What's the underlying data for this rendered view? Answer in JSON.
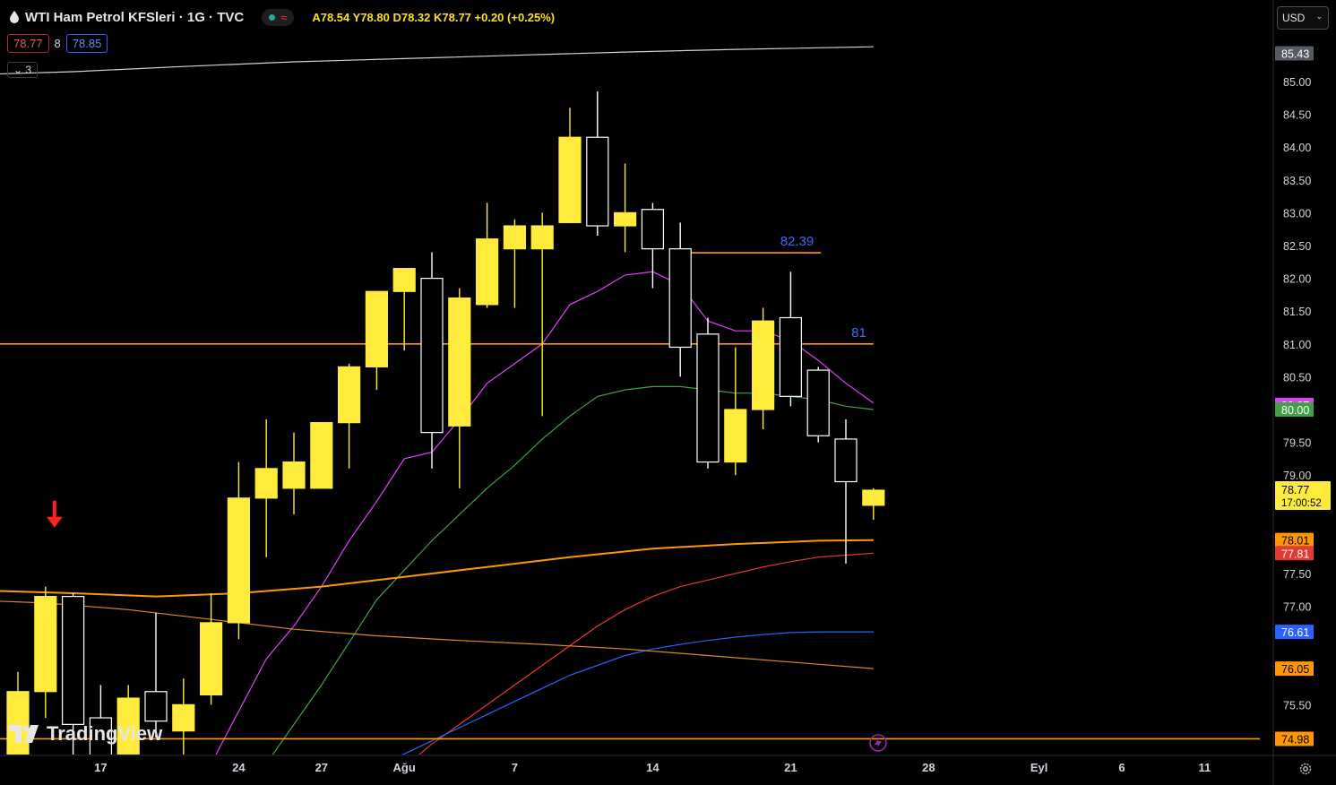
{
  "header": {
    "title": "WTI Ham Petrol KFSleri · 1G · TVC",
    "status_icon": "wave-icon",
    "ohlc_text": "A78.54  Y78.80  D78.32  K78.77  +0.20 (+0.25%)",
    "bid": "78.77",
    "spread": "8",
    "ask": "78.85",
    "indicators_count": "3",
    "currency": "USD"
  },
  "logo_text": "TradingView",
  "colors": {
    "bull": "#ffeb3b",
    "bear_fill": "#000000",
    "bear_border": "#ffffff",
    "hline": "#ff9800",
    "label_blue": "#3a6df0"
  },
  "chart_data": {
    "type": "candlestick",
    "y_range": [
      74.7,
      85.6
    ],
    "y_ticks": [
      "85.00",
      "84.50",
      "84.00",
      "83.50",
      "83.00",
      "82.50",
      "82.00",
      "81.50",
      "81.00",
      "80.50",
      "79.50",
      "79.00",
      "77.50",
      "77.00",
      "75.50"
    ],
    "x_ticks": [
      {
        "label": "17",
        "idx": 3
      },
      {
        "label": "24",
        "idx": 8
      },
      {
        "label": "27",
        "idx": 11
      },
      {
        "label": "Ağu",
        "idx": 14
      },
      {
        "label": "7",
        "idx": 18
      },
      {
        "label": "14",
        "idx": 23
      },
      {
        "label": "21",
        "idx": 28
      },
      {
        "label": "28",
        "idx": 33
      },
      {
        "label": "Eyl",
        "idx": 37
      },
      {
        "label": "6",
        "idx": 40
      },
      {
        "label": "11",
        "idx": 43
      }
    ],
    "candles": [
      {
        "o": 74.6,
        "h": 76.0,
        "l": 74.6,
        "c": 75.7
      },
      {
        "o": 75.7,
        "h": 77.3,
        "l": 75.3,
        "c": 77.15
      },
      {
        "o": 77.15,
        "h": 77.2,
        "l": 74.6,
        "c": 75.2
      },
      {
        "o": 75.3,
        "h": 75.8,
        "l": 74.6,
        "c": 74.6
      },
      {
        "o": 74.6,
        "h": 75.8,
        "l": 74.6,
        "c": 75.6
      },
      {
        "o": 75.7,
        "h": 76.9,
        "l": 75.0,
        "c": 75.25
      },
      {
        "o": 75.1,
        "h": 75.9,
        "l": 74.7,
        "c": 75.5
      },
      {
        "o": 75.65,
        "h": 77.2,
        "l": 75.5,
        "c": 76.75
      },
      {
        "o": 76.75,
        "h": 79.2,
        "l": 76.5,
        "c": 78.65
      },
      {
        "o": 78.65,
        "h": 79.85,
        "l": 77.75,
        "c": 79.1
      },
      {
        "o": 78.8,
        "h": 79.65,
        "l": 78.4,
        "c": 79.2
      },
      {
        "o": 78.8,
        "h": 79.8,
        "l": 78.8,
        "c": 79.8
      },
      {
        "o": 79.8,
        "h": 80.7,
        "l": 79.1,
        "c": 80.65
      },
      {
        "o": 80.65,
        "h": 81.8,
        "l": 80.3,
        "c": 81.8
      },
      {
        "o": 81.8,
        "h": 82.15,
        "l": 80.9,
        "c": 82.15
      },
      {
        "o": 82.0,
        "h": 82.4,
        "l": 79.1,
        "c": 79.65
      },
      {
        "o": 79.75,
        "h": 81.85,
        "l": 78.8,
        "c": 81.7
      },
      {
        "o": 81.6,
        "h": 83.15,
        "l": 81.55,
        "c": 82.6
      },
      {
        "o": 82.45,
        "h": 82.9,
        "l": 81.55,
        "c": 82.8
      },
      {
        "o": 82.45,
        "h": 83.0,
        "l": 79.9,
        "c": 82.8
      },
      {
        "o": 82.85,
        "h": 84.6,
        "l": 82.85,
        "c": 84.15
      },
      {
        "o": 84.15,
        "h": 84.85,
        "l": 82.65,
        "c": 82.8
      },
      {
        "o": 82.8,
        "h": 83.75,
        "l": 82.4,
        "c": 83.0
      },
      {
        "o": 83.05,
        "h": 83.15,
        "l": 81.85,
        "c": 82.45
      },
      {
        "o": 82.45,
        "h": 82.85,
        "l": 80.5,
        "c": 80.95
      },
      {
        "o": 81.15,
        "h": 81.4,
        "l": 79.1,
        "c": 79.2
      },
      {
        "o": 79.2,
        "h": 80.95,
        "l": 79.0,
        "c": 80.0
      },
      {
        "o": 80.0,
        "h": 81.55,
        "l": 79.7,
        "c": 81.35
      },
      {
        "o": 81.4,
        "h": 82.1,
        "l": 80.05,
        "c": 80.2
      },
      {
        "o": 80.6,
        "h": 80.65,
        "l": 79.5,
        "c": 79.6
      },
      {
        "o": 79.55,
        "h": 79.85,
        "l": 77.65,
        "c": 78.9
      },
      {
        "o": 78.54,
        "h": 78.8,
        "l": 78.32,
        "c": 78.77
      }
    ],
    "ma_lines": [
      {
        "color": "#d1d4dc",
        "points": [
          [
            -2,
            85.1
          ],
          [
            2,
            85.15
          ],
          [
            6,
            85.23
          ],
          [
            10,
            85.3
          ],
          [
            14,
            85.35
          ],
          [
            18,
            85.4
          ],
          [
            22,
            85.45
          ],
          [
            26,
            85.49
          ],
          [
            31,
            85.53
          ]
        ]
      },
      {
        "color": "#e040fb",
        "points": [
          [
            6,
            74.0
          ],
          [
            7,
            74.6
          ],
          [
            8,
            75.4
          ],
          [
            9,
            76.2
          ],
          [
            10,
            76.7
          ],
          [
            11,
            77.3
          ],
          [
            12,
            78.0
          ],
          [
            13,
            78.6
          ],
          [
            14,
            79.25
          ],
          [
            15,
            79.35
          ],
          [
            16,
            79.85
          ],
          [
            17,
            80.4
          ],
          [
            18,
            80.7
          ],
          [
            19,
            81.0
          ],
          [
            20,
            81.6
          ],
          [
            21,
            81.8
          ],
          [
            22,
            82.05
          ],
          [
            23,
            82.1
          ],
          [
            24,
            81.9
          ],
          [
            25,
            81.35
          ],
          [
            26,
            81.2
          ],
          [
            27,
            81.2
          ],
          [
            28,
            81.05
          ],
          [
            29,
            80.75
          ],
          [
            30,
            80.4
          ],
          [
            31,
            80.1
          ]
        ]
      },
      {
        "color": "#43a047",
        "points": [
          [
            9,
            74.6
          ],
          [
            10,
            75.2
          ],
          [
            11,
            75.8
          ],
          [
            12,
            76.45
          ],
          [
            13,
            77.1
          ],
          [
            14,
            77.55
          ],
          [
            15,
            78.0
          ],
          [
            16,
            78.4
          ],
          [
            17,
            78.8
          ],
          [
            18,
            79.15
          ],
          [
            19,
            79.55
          ],
          [
            20,
            79.9
          ],
          [
            21,
            80.2
          ],
          [
            22,
            80.3
          ],
          [
            23,
            80.35
          ],
          [
            24,
            80.35
          ],
          [
            25,
            80.3
          ],
          [
            26,
            80.25
          ],
          [
            27,
            80.25
          ],
          [
            28,
            80.2
          ],
          [
            29,
            80.15
          ],
          [
            30,
            80.05
          ],
          [
            31,
            80.0
          ]
        ]
      },
      {
        "color": "#e53935",
        "points": [
          [
            14,
            74.55
          ],
          [
            15,
            74.9
          ],
          [
            16,
            75.2
          ],
          [
            17,
            75.5
          ],
          [
            18,
            75.8
          ],
          [
            19,
            76.1
          ],
          [
            20,
            76.4
          ],
          [
            21,
            76.7
          ],
          [
            22,
            76.95
          ],
          [
            23,
            77.15
          ],
          [
            24,
            77.3
          ],
          [
            25,
            77.4
          ],
          [
            26,
            77.5
          ],
          [
            27,
            77.6
          ],
          [
            28,
            77.68
          ],
          [
            29,
            77.75
          ],
          [
            30,
            77.78
          ],
          [
            31,
            77.81
          ]
        ]
      },
      {
        "color": "#2962ff",
        "points": [
          [
            13,
            74.6
          ],
          [
            14,
            74.75
          ],
          [
            15,
            74.95
          ],
          [
            16,
            75.15
          ],
          [
            17,
            75.35
          ],
          [
            18,
            75.55
          ],
          [
            19,
            75.75
          ],
          [
            20,
            75.95
          ],
          [
            21,
            76.1
          ],
          [
            22,
            76.25
          ],
          [
            23,
            76.35
          ],
          [
            24,
            76.42
          ],
          [
            25,
            76.48
          ],
          [
            26,
            76.53
          ],
          [
            27,
            76.57
          ],
          [
            28,
            76.6
          ],
          [
            29,
            76.61
          ],
          [
            30,
            76.61
          ],
          [
            31,
            76.61
          ]
        ]
      },
      {
        "color": "#ff9800",
        "width": 2,
        "points": [
          [
            -2,
            77.25
          ],
          [
            2,
            77.2
          ],
          [
            5,
            77.15
          ],
          [
            8,
            77.2
          ],
          [
            11,
            77.3
          ],
          [
            14,
            77.45
          ],
          [
            17,
            77.6
          ],
          [
            20,
            77.75
          ],
          [
            23,
            77.88
          ],
          [
            26,
            77.95
          ],
          [
            29,
            78.0
          ],
          [
            31,
            78.01
          ]
        ]
      },
      {
        "color": "#e08a1e",
        "points": [
          [
            -2,
            77.1
          ],
          [
            1,
            77.05
          ],
          [
            4,
            76.95
          ],
          [
            7,
            76.8
          ],
          [
            10,
            76.65
          ],
          [
            13,
            76.55
          ],
          [
            16,
            76.48
          ],
          [
            19,
            76.42
          ],
          [
            22,
            76.35
          ],
          [
            25,
            76.25
          ],
          [
            28,
            76.15
          ],
          [
            31,
            76.05
          ]
        ]
      }
    ],
    "hlines": [
      {
        "value": 81.0,
        "from": -2,
        "to": 31,
        "label": "81"
      },
      {
        "value": 82.39,
        "from": 24.3,
        "to": 29.1,
        "label": "82.39"
      },
      {
        "value": 74.98,
        "from": -2,
        "to": 45,
        "label": ""
      }
    ],
    "price_labels": [
      {
        "value": 85.43,
        "text": "85.43",
        "bg": "#555a63",
        "fg": "#ffffff"
      },
      {
        "value": 80.07,
        "text": "80.07",
        "bg": "#e040fb",
        "fg": "#ffffff"
      },
      {
        "value": 80.0,
        "text": "80.00",
        "bg": "#43a047",
        "fg": "#ffffff"
      },
      {
        "value": 78.01,
        "text": "78.01",
        "bg": "#ff9800",
        "fg": "#000000"
      },
      {
        "value": 77.81,
        "text": "77.81",
        "bg": "#e53935",
        "fg": "#ffffff"
      },
      {
        "value": 76.61,
        "text": "76.61",
        "bg": "#2962ff",
        "fg": "#ffffff"
      },
      {
        "value": 76.05,
        "text": "76.05",
        "bg": "#ff9800",
        "fg": "#000000"
      },
      {
        "value": 74.98,
        "text": "74.98",
        "bg": "#ff9800",
        "fg": "#000000"
      }
    ],
    "last_price": {
      "value": 78.77,
      "text": "78.77",
      "countdown": "17:00:52",
      "bg": "#ffeb3b",
      "fg": "#000000"
    },
    "marker": {
      "idx": 1,
      "value": 78.2,
      "kind": "down-arrow",
      "color": "#ff1f1f"
    }
  }
}
